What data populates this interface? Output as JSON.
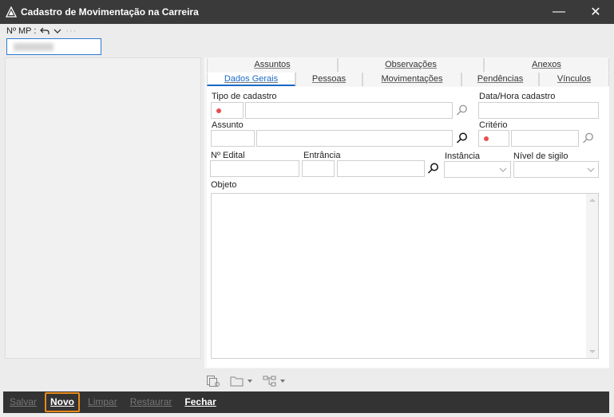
{
  "window": {
    "title": "Cadastro de Movimentação na Carreira",
    "minimize_glyph": "—",
    "close_glyph": "✕"
  },
  "header": {
    "mp_label": "Nº MP :",
    "mp_value": "",
    "undo_icon": "undo-icon",
    "more_glyph": "···"
  },
  "tabs": {
    "row1": [
      {
        "label": "Assuntos"
      },
      {
        "label": "Observações"
      },
      {
        "label": "Anexos"
      }
    ],
    "row2": [
      {
        "label": "Dados Gerais",
        "active": true
      },
      {
        "label": "Pessoas"
      },
      {
        "label": "Movimentações"
      },
      {
        "label": "Pendências"
      },
      {
        "label": "Vínculos"
      }
    ]
  },
  "form": {
    "tipo_cadastro_label": "Tipo de cadastro",
    "data_hora_label": "Data/Hora cadastro",
    "assunto_label": "Assunto",
    "criterio_label": "Critério",
    "edital_label": "Nº Edital",
    "entrancia_label": "Entrância",
    "instancia_label": "Instância",
    "sigilo_label": "Nível de sigilo",
    "objeto_label": "Objeto"
  },
  "actions": {
    "salvar": "Salvar",
    "novo": "Novo",
    "limpar": "Limpar",
    "restaurar": "Restaurar",
    "fechar": "Fechar"
  },
  "colors": {
    "titlebar": "#3a3a3a",
    "accent": "#1a6bc7",
    "required": "#e85050",
    "focus": "#e88a1a"
  }
}
